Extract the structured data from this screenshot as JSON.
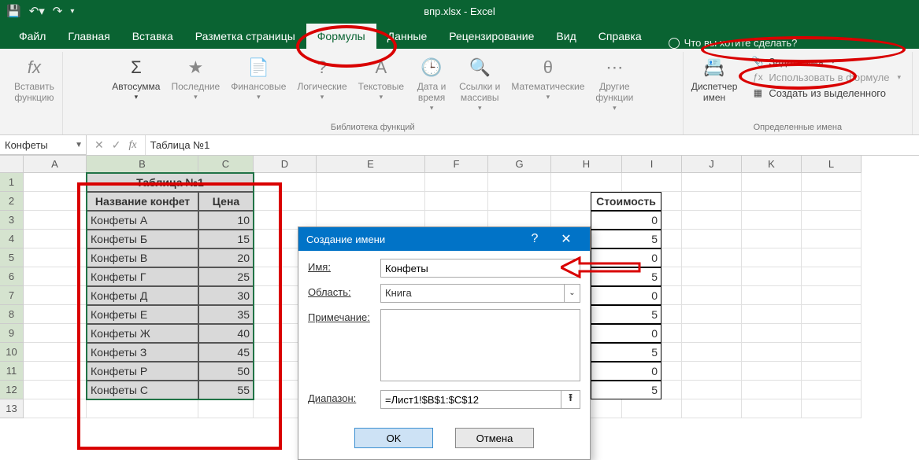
{
  "window": {
    "title": "впр.xlsx  -  Excel"
  },
  "tabs": {
    "file": "Файл",
    "home": "Главная",
    "insert": "Вставка",
    "layout": "Разметка страницы",
    "formulas": "Формулы",
    "data": "Данные",
    "review": "Рецензирование",
    "view": "Вид",
    "help": "Справка",
    "tellme": "Что вы хотите сделать?"
  },
  "ribbon": {
    "insertfn": "Вставить\nфункцию",
    "autosum": "Автосумма",
    "recent": "Последние",
    "financial": "Финансовые",
    "logical": "Логические",
    "text": "Текстовые",
    "datetime": "Дата и\nвремя",
    "lookup": "Ссылки и\nмассивы",
    "math": "Математические",
    "more": "Другие\nфункции",
    "lib_group": "Библиотека функций",
    "namemgr": "Диспетчер\nимен",
    "define": "Задать имя",
    "useinf": "Использовать в формуле",
    "createfs": "Создать из выделенного",
    "names_group": "Определенные имена"
  },
  "namebox": "Конфеты",
  "formula": "Таблица №1",
  "columns": [
    "A",
    "B",
    "C",
    "D",
    "E",
    "F",
    "G",
    "H",
    "I",
    "J",
    "K",
    "L"
  ],
  "rows": [
    "1",
    "2",
    "3",
    "4",
    "5",
    "6",
    "7",
    "8",
    "9",
    "10",
    "11",
    "12",
    "13"
  ],
  "table1": {
    "title": "Таблица №1",
    "h1": "Название конфет",
    "h2": "Цена",
    "rows": [
      {
        "n": "Конфеты А",
        "p": "10"
      },
      {
        "n": "Конфеты Б",
        "p": "15"
      },
      {
        "n": "Конфеты В",
        "p": "20"
      },
      {
        "n": "Конфеты Г",
        "p": "25"
      },
      {
        "n": "Конфеты Д",
        "p": "30"
      },
      {
        "n": "Конфеты Е",
        "p": "35"
      },
      {
        "n": "Конфеты Ж",
        "p": "40"
      },
      {
        "n": "Конфеты З",
        "p": "45"
      },
      {
        "n": "Конфеты Р",
        "p": "50"
      },
      {
        "n": "Конфеты С",
        "p": "55"
      }
    ]
  },
  "table2": {
    "h4": "Стоимость",
    "vals": [
      "0",
      "5",
      "0",
      "5",
      "0",
      "5",
      "0",
      "5",
      "0",
      "5"
    ]
  },
  "dialog": {
    "title": "Создание имени",
    "name_lbl": "Имя:",
    "name_val": "Конфеты",
    "scope_lbl": "Область:",
    "scope_val": "Книга",
    "comment_lbl": "Примечание:",
    "range_lbl": "Диапазон:",
    "range_val": "=Лист1!$B$1:$C$12",
    "ok": "OK",
    "cancel": "Отмена",
    "help": "?",
    "close": "✕"
  }
}
